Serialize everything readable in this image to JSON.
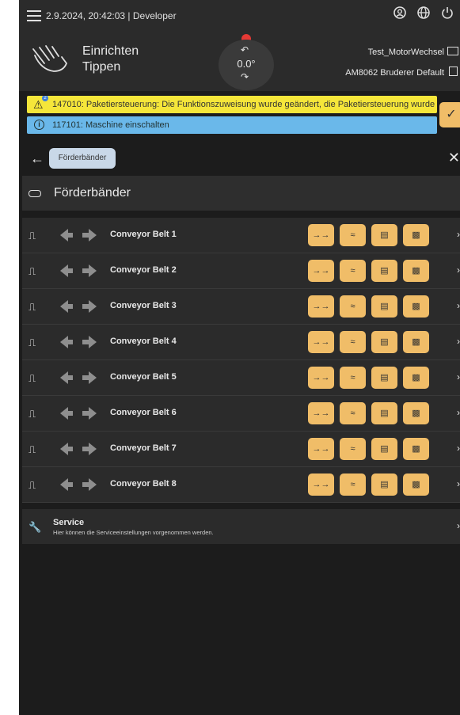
{
  "topbar": {
    "status": "2.9.2024, 20:42:03 | Developer",
    "icons": [
      "account-icon",
      "language-icon",
      "power-icon"
    ]
  },
  "header": {
    "mode_line1": "Einrichten",
    "mode_line2": "Tippen",
    "dial_value": "0.0°",
    "machine": "Test_MotorWechsel",
    "product": "AM8062 Bruderer Default"
  },
  "messages": {
    "warning_code": "147010",
    "warning_text": "147010: Paketiersteuerung: Die Funktionszuweisung wurde geändert, die Paketiersteuerung wurde",
    "warning_badge": "2",
    "info_text": "117101: Maschine einschalten"
  },
  "nav": {
    "breadcrumb": "Förderbänder"
  },
  "section": {
    "title": "Förderbänder"
  },
  "belts": [
    {
      "label": "Conveyor Belt 1"
    },
    {
      "label": "Conveyor Belt 2"
    },
    {
      "label": "Conveyor Belt 3"
    },
    {
      "label": "Conveyor Belt 4"
    },
    {
      "label": "Conveyor Belt 5"
    },
    {
      "label": "Conveyor Belt 6"
    },
    {
      "label": "Conveyor Belt 7"
    },
    {
      "label": "Conveyor Belt 8"
    }
  ],
  "belt_actions": [
    "belt-run-icon",
    "belt-jog-icon",
    "belt-sensor-icon",
    "belt-settings-icon"
  ],
  "service": {
    "title": "Service",
    "subtitle": "Hier können die Serviceeinstellungen vorgenommen werden."
  },
  "colors": {
    "accent_orange": "#f0bd68",
    "warning_yellow": "#f5e63a",
    "info_blue": "#6ab8ea",
    "status_red": "#e53935"
  }
}
